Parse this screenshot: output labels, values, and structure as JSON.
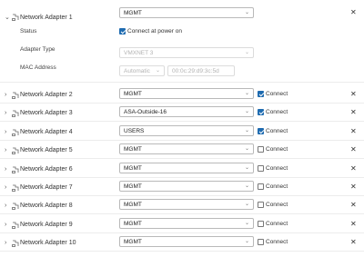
{
  "adapter1": {
    "name": "Network Adapter 1",
    "network": "MGMT",
    "status_label": "Status",
    "status_text": "Connect at power on",
    "status_checked": true,
    "type_label": "Adapter Type",
    "type_value": "VMXNET 3",
    "mac_label": "MAC Address",
    "mac_mode": "Automatic",
    "mac_value": "00:0c:29:d9:3c:5d",
    "expand_icon": "chevron-down-icon",
    "icon": "network-adapter-icon"
  },
  "adapters": [
    {
      "name": "Network Adapter 2",
      "network": "MGMT",
      "connect_label": "Connect",
      "connected": true
    },
    {
      "name": "Network Adapter 3",
      "network": "ASA-Outside-16",
      "connect_label": "Connect",
      "connected": true
    },
    {
      "name": "Network Adapter 4",
      "network": "USERS",
      "connect_label": "Connect",
      "connected": true
    },
    {
      "name": "Network Adapter 5",
      "network": "MGMT",
      "connect_label": "Connect",
      "connected": false
    },
    {
      "name": "Network Adapter 6",
      "network": "MGMT",
      "connect_label": "Connect",
      "connected": false
    },
    {
      "name": "Network Adapter 7",
      "network": "MGMT",
      "connect_label": "Connect",
      "connected": false
    },
    {
      "name": "Network Adapter 8",
      "network": "MGMT",
      "connect_label": "Connect",
      "connected": false
    },
    {
      "name": "Network Adapter 9",
      "network": "MGMT",
      "connect_label": "Connect",
      "connected": false
    },
    {
      "name": "Network Adapter 10",
      "network": "MGMT",
      "connect_label": "Connect",
      "connected": false
    }
  ],
  "icons": {
    "collapsed": "chevron-right-icon",
    "remove": "close-icon",
    "dropdown": "chevron-down-icon"
  },
  "colors": {
    "checkbox_checked": "#1e6bb0",
    "border": "#b9b9b9",
    "divider": "#ececec"
  }
}
